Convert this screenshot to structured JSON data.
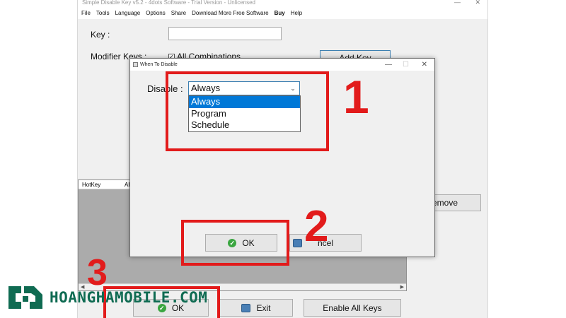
{
  "main_window": {
    "title": "Simple Disable Key v5.2 - 4dots Software - Trial Version - Unlicensed",
    "menu": [
      "File",
      "Tools",
      "Language",
      "Options",
      "Share",
      "Download More Free Software",
      "Buy",
      "Help"
    ],
    "key_label": "Key :",
    "key_value": "",
    "modifier_label": "Modifier Keys :",
    "all_combinations_label": "All Combinations",
    "add_key_label": "Add Key",
    "list_columns": [
      "HotKey",
      "Al"
    ],
    "remove_label": "emove",
    "ok_label": "OK",
    "exit_label": "Exit",
    "enable_all_label": "Enable All Keys"
  },
  "dialog": {
    "title": "When To Disable",
    "disable_label": "Disable :",
    "selected": "Always",
    "options": [
      "Always",
      "Program",
      "Schedule"
    ],
    "ok_label": "OK",
    "cancel_label": "ncel"
  },
  "annotations": [
    "1",
    "2",
    "3"
  ],
  "logo": {
    "text": "HOANGHAMOBILE.COM"
  },
  "colors": {
    "annotation_red": "#e21b1b",
    "selection_blue": "#0078d7",
    "logo_green": "#0f6b52"
  }
}
